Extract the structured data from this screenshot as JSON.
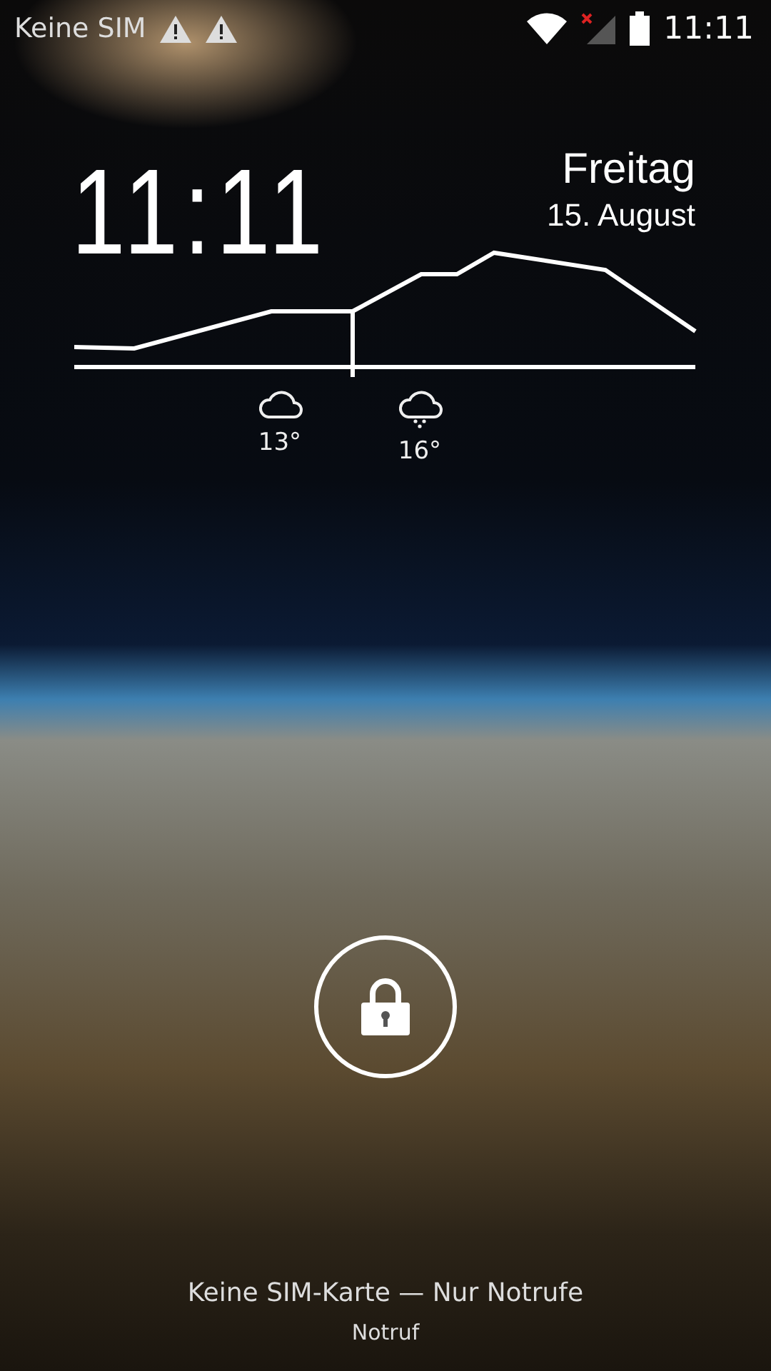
{
  "status_bar": {
    "carrier": "Keine SIM",
    "warnings": [
      {
        "kind": "alert"
      },
      {
        "kind": "alert"
      }
    ],
    "time": "11:11"
  },
  "clock": {
    "time": "11:11",
    "weekday": "Freitag",
    "date": "15. August"
  },
  "forecast": [
    {
      "kind": "cloudy",
      "temp": "13°"
    },
    {
      "kind": "rain",
      "temp": "16°"
    }
  ],
  "footer": {
    "status": "Keine SIM-Karte — Nur Notrufe",
    "emergency": "Notruf"
  }
}
